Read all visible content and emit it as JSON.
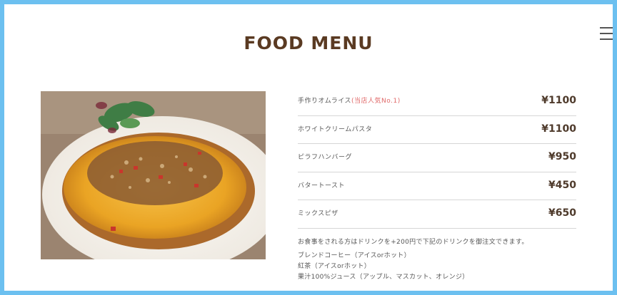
{
  "title": "FOOD MENU",
  "menu": [
    {
      "name": "手作りオムライス",
      "highlight": "(当店人気No.1)",
      "price": "¥1100"
    },
    {
      "name": "ホワイトクリームパスタ",
      "highlight": "",
      "price": "¥1100"
    },
    {
      "name": "ピラフハンバーグ",
      "highlight": "",
      "price": "¥950"
    },
    {
      "name": "バタートースト",
      "highlight": "",
      "price": "¥450"
    },
    {
      "name": "ミックスピザ",
      "highlight": "",
      "price": "¥650"
    }
  ],
  "note": "お食事をされる方はドリンクを+200円で下記のドリンクを御注文できます。",
  "drinks": [
    "ブレンドコーヒー（アイスorホット）",
    "紅茶（アイスorホット）",
    "果汁100%ジュース（アップル、マスカット、オレンジ）"
  ],
  "colors": {
    "frame": "#6cc0f0",
    "title": "#5a3a22",
    "highlight": "#e06a6a",
    "price": "#4e3a2b"
  },
  "icons": {
    "menu": "hamburger-menu-icon"
  }
}
